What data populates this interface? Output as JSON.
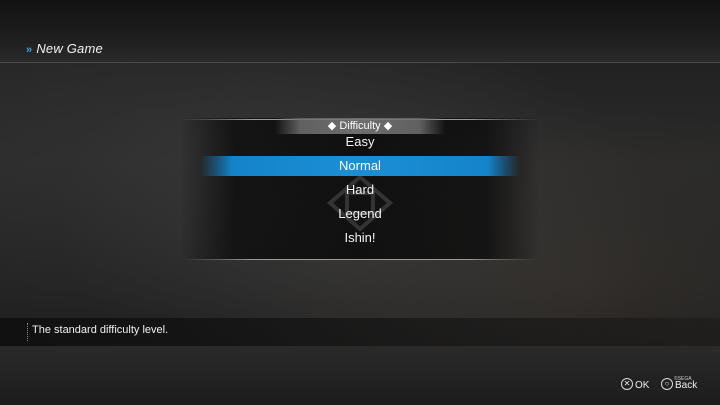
{
  "header": {
    "chevrons": "»",
    "title": "New Game"
  },
  "menu": {
    "heading": "◆ Difficulty ◆",
    "selected_index": 1,
    "items": [
      {
        "label": "Easy"
      },
      {
        "label": "Normal"
      },
      {
        "label": "Hard"
      },
      {
        "label": "Legend"
      },
      {
        "label": "Ishin!"
      }
    ]
  },
  "description": {
    "text": "The standard difficulty level."
  },
  "prompts": {
    "ok": {
      "icon": "cross-button-icon",
      "glyph": "✕",
      "label": "OK"
    },
    "back": {
      "icon": "circle-button-icon",
      "glyph": "○",
      "label": "Back"
    }
  },
  "copyright": "©SEGA",
  "colors": {
    "accent": "#1b8fd6",
    "chevron": "#39a4d8"
  }
}
